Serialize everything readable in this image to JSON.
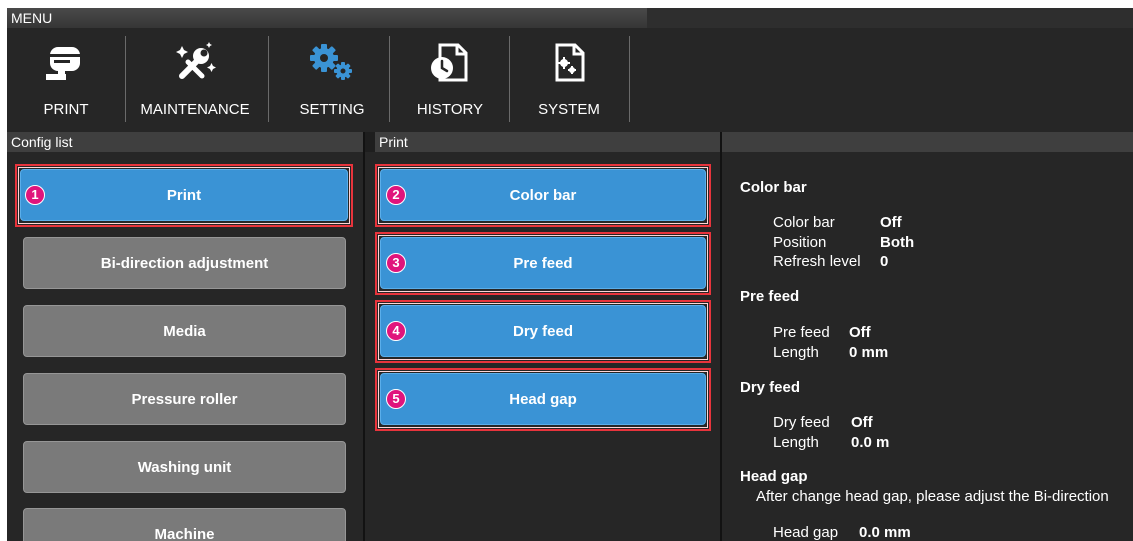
{
  "menubar": {
    "title": "MENU"
  },
  "toolbar": {
    "items": [
      {
        "label": "PRINT",
        "icon": "print-icon"
      },
      {
        "label": "MAINTENANCE",
        "icon": "maintenance-icon"
      },
      {
        "label": "SETTING",
        "icon": "setting-icon",
        "accent": "#3a93d5"
      },
      {
        "label": "HISTORY",
        "icon": "history-icon"
      },
      {
        "label": "SYSTEM",
        "icon": "system-icon"
      }
    ]
  },
  "config_list": {
    "header": "Config list",
    "items": [
      {
        "label": "Print",
        "selected": true,
        "marker": "1"
      },
      {
        "label": "Bi-direction adjustment",
        "selected": false
      },
      {
        "label": "Media",
        "selected": false
      },
      {
        "label": "Pressure roller",
        "selected": false
      },
      {
        "label": "Washing unit",
        "selected": false
      },
      {
        "label": "Machine",
        "selected": false
      }
    ]
  },
  "print_panel": {
    "header": "Print",
    "items": [
      {
        "label": "Color bar",
        "marker": "2"
      },
      {
        "label": "Pre feed",
        "marker": "3"
      },
      {
        "label": "Dry feed",
        "marker": "4"
      },
      {
        "label": "Head gap",
        "marker": "5"
      }
    ]
  },
  "details": {
    "color_bar": {
      "title": "Color bar",
      "rows": [
        {
          "key": "Color bar",
          "value": "Off"
        },
        {
          "key": "Position",
          "value": "Both"
        },
        {
          "key": "Refresh level",
          "value": "0"
        }
      ]
    },
    "pre_feed": {
      "title": "Pre feed",
      "rows": [
        {
          "key": "Pre feed",
          "value": "Off"
        },
        {
          "key": "Length",
          "value": "0 mm"
        }
      ]
    },
    "dry_feed": {
      "title": "Dry feed",
      "rows": [
        {
          "key": "Dry feed",
          "value": "Off"
        },
        {
          "key": "Length",
          "value": "0.0 m"
        }
      ]
    },
    "head_gap": {
      "title": "Head gap",
      "note": "After change head gap, please adjust the Bi-direction",
      "rows": [
        {
          "key": "Head gap",
          "value": "0.0 mm"
        }
      ]
    }
  },
  "colors": {
    "accent": "#3a93d5",
    "highlight": "#e8343c",
    "marker": "#e0147c",
    "button_gray": "#7a7a7a"
  }
}
